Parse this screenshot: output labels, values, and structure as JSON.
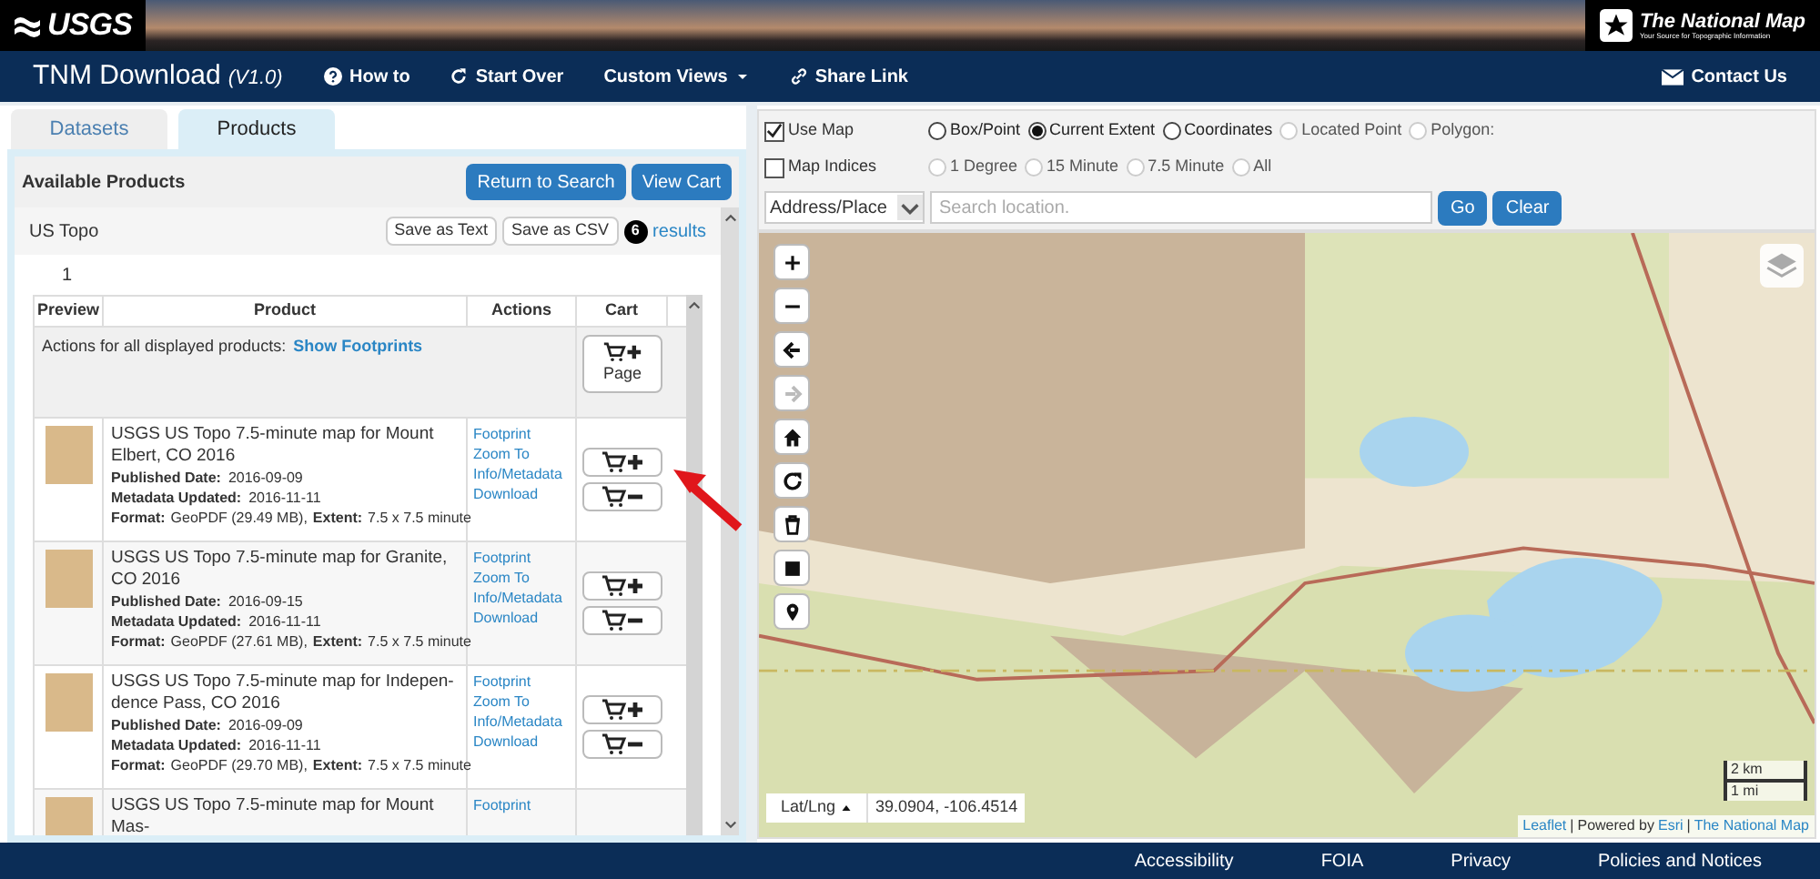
{
  "banner": {
    "left_logo": "USGS",
    "right_logo": "The National Map",
    "right_tagline": "Your Source for Topographic Information"
  },
  "navbar": {
    "title": "TNM Download",
    "version": "(V1.0)",
    "items": [
      {
        "label": "How to",
        "kind": "help"
      },
      {
        "label": "Start Over",
        "kind": "refresh"
      },
      {
        "label": "Custom Views",
        "kind": "dropdown"
      },
      {
        "label": "Share Link",
        "kind": "link"
      }
    ],
    "contact": "Contact Us"
  },
  "tabs": [
    {
      "label": "Datasets",
      "selected": false
    },
    {
      "label": "Products",
      "selected": true
    }
  ],
  "products_panel": {
    "title": "Available Products",
    "buttons": [
      "Return to Search",
      "View Cart"
    ],
    "dataset": "US Topo",
    "save_buttons": [
      "Save as Text",
      "Save as CSV"
    ],
    "result_count": "6",
    "results_label": "results",
    "page": "1",
    "columns": [
      "Preview",
      "Product",
      "Actions",
      "Cart"
    ],
    "all_actions_label": "Actions for all displayed products:",
    "all_actions_link": "Show Footprints",
    "page_button": "Page",
    "rows": [
      {
        "title": "USGS US Topo 7.5-minute map for Mount Elbert, CO 2016",
        "published_label": "Published Date:",
        "published": "2016-09-09",
        "updated_label": "Metadata Updated:",
        "updated": "2016-11-11",
        "format_label": "Format:",
        "format": "GeoPDF (29.49 MB),",
        "extent_label": "Extent:",
        "extent": "7.5 x 7.5 minute",
        "actions": [
          "Footprint",
          "Zoom To",
          "Info/Metadata",
          "Download"
        ]
      },
      {
        "title": "USGS US Topo 7.5-minute map for Granite, CO 2016",
        "published_label": "Published Date:",
        "published": "2016-09-15",
        "updated_label": "Metadata Updated:",
        "updated": "2016-11-11",
        "format_label": "Format:",
        "format": "GeoPDF (27.61 MB),",
        "extent_label": "Extent:",
        "extent": "7.5 x 7.5 minute",
        "actions": [
          "Footprint",
          "Zoom To",
          "Info/Metadata",
          "Download"
        ]
      },
      {
        "title": "USGS US Topo 7.5-minute map for Indepen-dence Pass, CO 2016",
        "published_label": "Published Date:",
        "published": "2016-09-09",
        "updated_label": "Metadata Updated:",
        "updated": "2016-11-11",
        "format_label": "Format:",
        "format": "GeoPDF (29.70 MB),",
        "extent_label": "Extent:",
        "extent": "7.5 x 7.5 minute",
        "actions": [
          "Footprint",
          "Zoom To",
          "Info/Metadata",
          "Download"
        ]
      },
      {
        "title": "USGS US Topo 7.5-minute map for Mount Mas-",
        "actions": [
          "Footprint"
        ]
      }
    ]
  },
  "map_options": {
    "use_map": {
      "label": "Use Map",
      "checked": true
    },
    "map_indices": {
      "label": "Map Indices",
      "checked": false
    },
    "extent_options": [
      {
        "label": "Box/Point",
        "selected": false,
        "disabled": false
      },
      {
        "label": "Current Extent",
        "selected": true,
        "disabled": false
      },
      {
        "label": "Coordinates",
        "selected": false,
        "disabled": false
      },
      {
        "label": "Located Point",
        "selected": false,
        "disabled": true
      },
      {
        "label": "Polygon:",
        "selected": false,
        "disabled": true
      }
    ],
    "index_options": [
      {
        "label": "1 Degree",
        "selected": false,
        "disabled": true
      },
      {
        "label": "15 Minute",
        "selected": false,
        "disabled": true
      },
      {
        "label": "7.5 Minute",
        "selected": false,
        "disabled": true
      },
      {
        "label": "All",
        "selected": false,
        "disabled": true
      }
    ],
    "search_type": "Address/Place",
    "search_placeholder": "Search location.",
    "buttons": [
      "Go",
      "Clear"
    ]
  },
  "map": {
    "controls": [
      {
        "kind": "zoom-in",
        "disabled": false
      },
      {
        "kind": "zoom-out",
        "disabled": false
      },
      {
        "kind": "back",
        "disabled": false
      },
      {
        "kind": "forward",
        "disabled": true
      },
      {
        "kind": "home",
        "disabled": false
      },
      {
        "kind": "refresh",
        "disabled": false
      },
      {
        "kind": "trash",
        "disabled": false
      },
      {
        "kind": "square",
        "disabled": false
      },
      {
        "kind": "pin",
        "disabled": false
      }
    ],
    "coord_mode": "Lat/Lng",
    "coords": "39.0904, -106.4514",
    "scale": [
      "2 km",
      "1 mi"
    ],
    "attribution": [
      {
        "text": "Leaflet",
        "link": true
      },
      {
        "text": "|",
        "link": false
      },
      {
        "text": "Powered by",
        "link": false
      },
      {
        "text": "Esri",
        "link": true
      },
      {
        "text": "|",
        "link": false
      },
      {
        "text": "The National Map",
        "link": true
      }
    ]
  },
  "footer": [
    "Accessibility",
    "FOIA",
    "Privacy",
    "Policies and Notices"
  ]
}
